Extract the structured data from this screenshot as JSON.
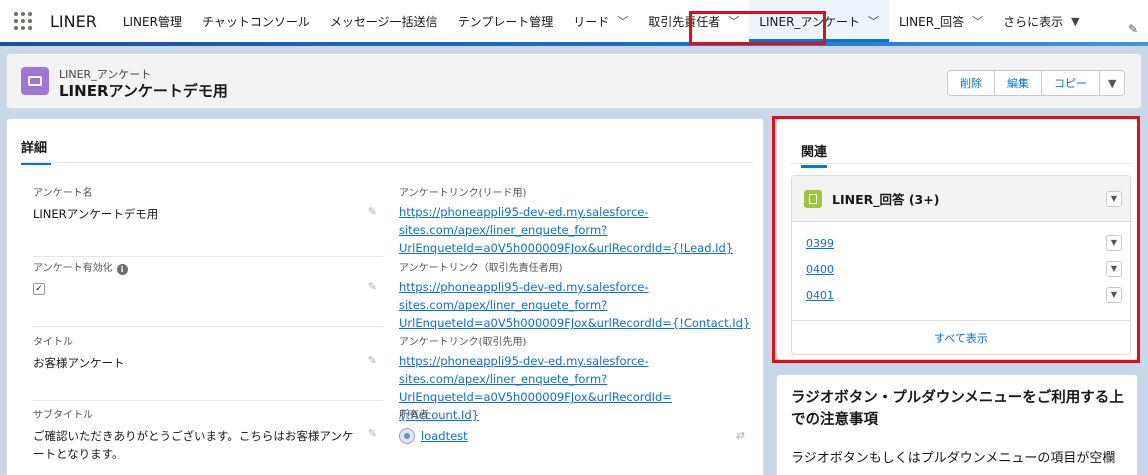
{
  "app": {
    "name": "LINER"
  },
  "nav": {
    "items": [
      {
        "label": "LINER管理",
        "chevron": false
      },
      {
        "label": "チャットコンソール",
        "chevron": false
      },
      {
        "label": "メッセージ一括送信",
        "chevron": false
      },
      {
        "label": "テンプレート管理",
        "chevron": false
      },
      {
        "label": "リード",
        "chevron": true
      },
      {
        "label": "取引先責任者",
        "chevron": true
      },
      {
        "label": "LINER_アンケート",
        "chevron": true,
        "active": true
      },
      {
        "label": "LINER_回答",
        "chevron": true
      },
      {
        "label": "さらに表示",
        "chevron": true
      }
    ]
  },
  "header": {
    "object_type": "LINER_アンケート",
    "title": "LINERアンケートデモ用",
    "buttons": {
      "delete": "削除",
      "edit": "編集",
      "copy": "コピー"
    }
  },
  "detail": {
    "tab": "詳細",
    "left": [
      {
        "label": "アンケート名",
        "value": "LINERアンケートデモ用"
      },
      {
        "label": "アンケート有効化",
        "checked": true
      },
      {
        "label": "タイトル",
        "value": "お客様アンケート"
      },
      {
        "label": "サブタイトル",
        "value": "ご確認いただきありがとうございます。こちらはお客様アンケートとなります。"
      }
    ],
    "right": [
      {
        "label": "アンケートリンク(リード用)",
        "lines": [
          "https://phoneappli95-dev-ed.my.salesforce-",
          "sites.com/apex/liner_enquete_form?",
          "UrlEnqueteId=a0V5h000009FJox&urlRecordId={!Lead.Id}"
        ]
      },
      {
        "label": "アンケートリンク（取引先責任者用)",
        "lines": [
          "https://phoneappli95-dev-ed.my.salesforce-",
          "sites.com/apex/liner_enquete_form?",
          "UrlEnqueteId=a0V5h000009FJox&urlRecordId={!Contact.Id}"
        ]
      },
      {
        "label": "アンケートリンク(取引先用)",
        "lines": [
          "https://phoneappli95-dev-ed.my.salesforce-",
          "sites.com/apex/liner_enquete_form?",
          "UrlEnqueteId=a0V5h000009FJox&urlRecordId={!Account.Id}"
        ]
      },
      {
        "label": "所有者",
        "owner": "loadtest"
      }
    ]
  },
  "related": {
    "tab": "関連",
    "list_title": "LINER_回答 (3+)",
    "rows": [
      "0399",
      "0400",
      "0401"
    ],
    "view_all": "すべて表示"
  },
  "notice": {
    "title": "ラジオボタン・プルダウンメニューをご利用する上での注意事項",
    "body": "ラジオボタンもしくはプルダウンメニューの項目が空欄"
  },
  "colors": {
    "highlight": "#e00d1e",
    "brand": "#0176d3",
    "link": "#0b6fd1"
  }
}
